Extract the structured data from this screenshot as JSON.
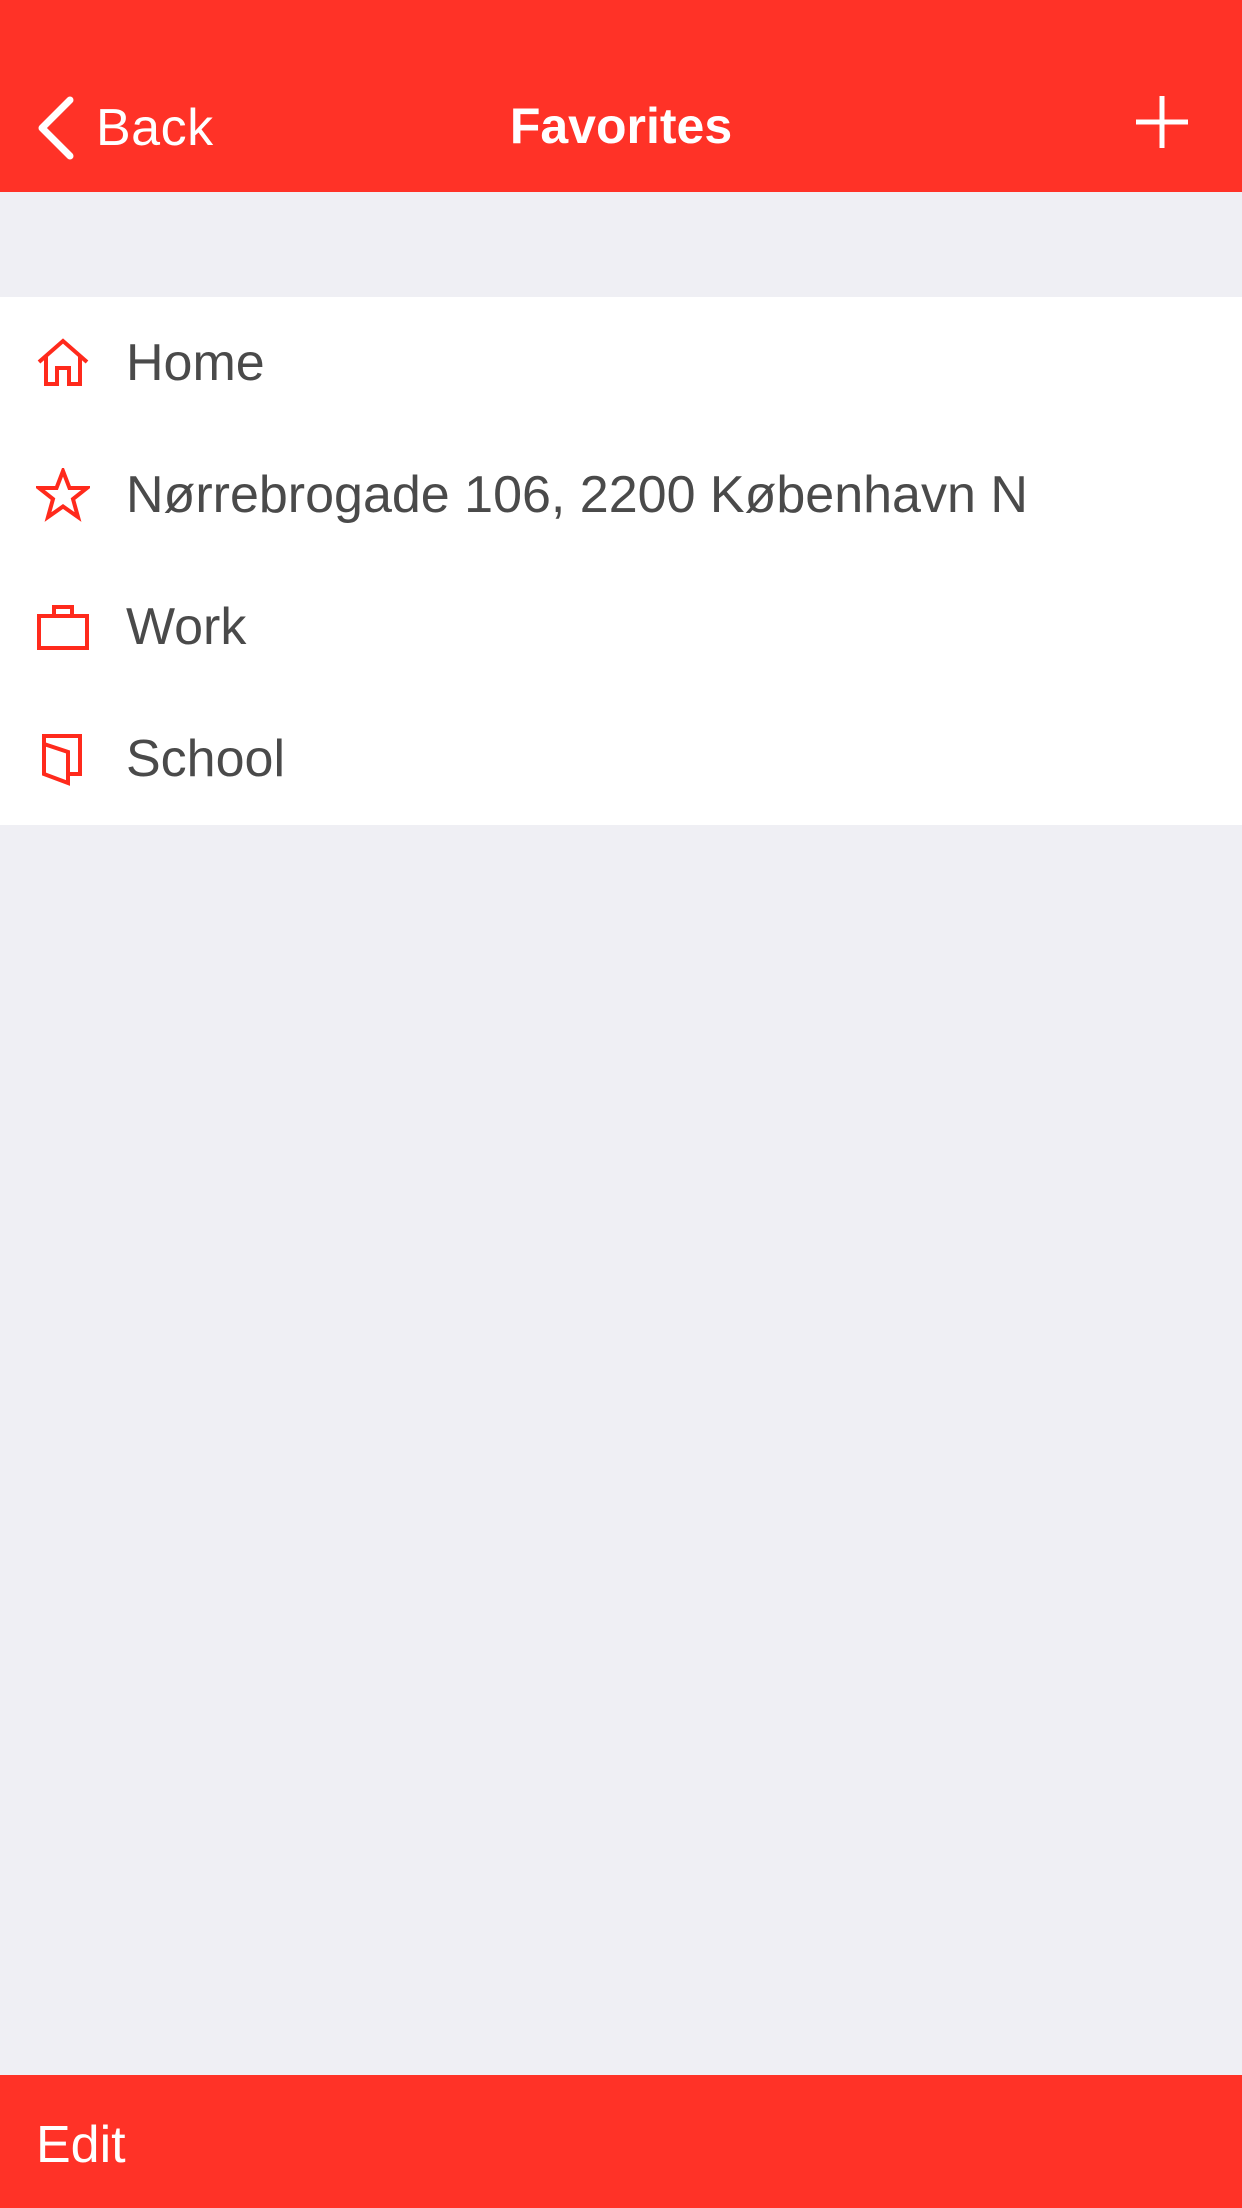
{
  "colors": {
    "accent": "#ff3227",
    "background": "#efeff4",
    "row_background": "#ffffff",
    "row_text": "#4a4a4a"
  },
  "navbar": {
    "back_label": "Back",
    "title": "Favorites",
    "back_icon": "chevron-left-icon",
    "add_icon": "plus-icon"
  },
  "favorites": [
    {
      "icon": "home-icon",
      "label": "Home"
    },
    {
      "icon": "star-icon",
      "label": "Nørrebrogade 106, 2200 København N"
    },
    {
      "icon": "briefcase-icon",
      "label": "Work"
    },
    {
      "icon": "book-icon",
      "label": "School"
    }
  ],
  "toolbar": {
    "edit_label": "Edit"
  }
}
